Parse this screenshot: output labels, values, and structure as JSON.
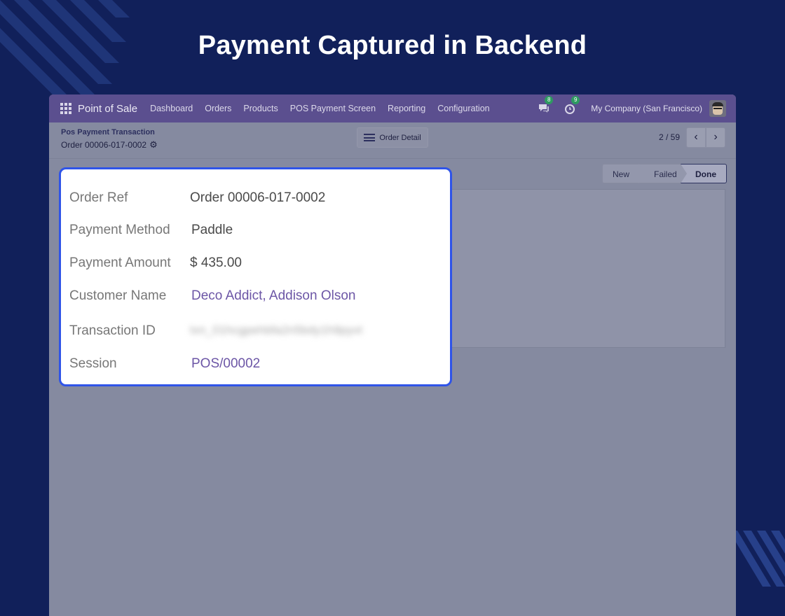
{
  "headline": "Payment Captured in Backend",
  "navbar": {
    "app_name": "Point of Sale",
    "menu": [
      "Dashboard",
      "Orders",
      "Products",
      "POS Payment Screen",
      "Reporting",
      "Configuration"
    ],
    "messages_badge": "8",
    "activities_badge": "9",
    "company": "My Company (San Francisco)"
  },
  "breadcrumb": {
    "parent": "Pos Payment Transaction",
    "current": "Order 00006-017-0002"
  },
  "order_detail_button": "Order Detail",
  "pager": {
    "text": "2 / 59"
  },
  "status": {
    "stages": [
      "New",
      "Failed",
      "Done"
    ],
    "active": "Done"
  },
  "details": {
    "order_ref": {
      "label": "Order Ref",
      "value": "Order 00006-017-0002"
    },
    "payment_method": {
      "label": "Payment Method",
      "value": "Paddle"
    },
    "payment_amount": {
      "label": "Payment Amount",
      "value": "$ 435.00"
    },
    "customer_name": {
      "label": "Customer Name",
      "value": "Deco Addict, Addison Olson"
    },
    "transaction_id": {
      "label": "Transaction ID",
      "value": "txn_01hcgpehbfa2n5bdy1h9pyvt"
    },
    "session": {
      "label": "Session",
      "value": "POS/00002"
    }
  },
  "colors": {
    "background": "#11205a",
    "navbar": "#5b4f8f",
    "callout_border": "#2f54e8",
    "link": "#6c56a6"
  }
}
